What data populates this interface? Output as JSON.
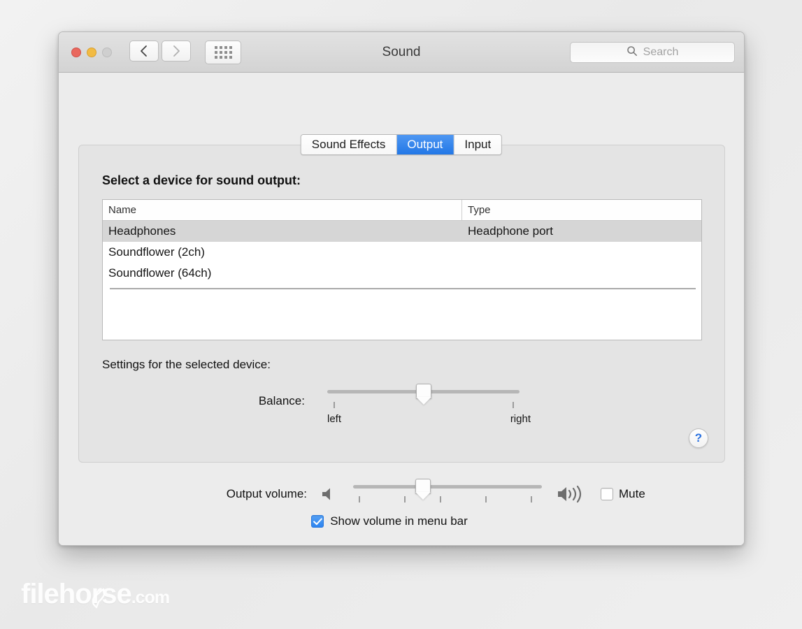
{
  "window": {
    "title": "Sound",
    "traffic_lights": [
      "close",
      "minimize",
      "zoom"
    ],
    "nav": {
      "back": "back-chevron",
      "forward": "forward-chevron",
      "show_all": "grid-icon"
    },
    "search": {
      "placeholder": "Search",
      "icon": "search-icon",
      "value": ""
    }
  },
  "tabs": [
    {
      "label": "Sound Effects",
      "selected": false
    },
    {
      "label": "Output",
      "selected": true
    },
    {
      "label": "Input",
      "selected": false
    }
  ],
  "panel": {
    "heading": "Select a device for sound output:",
    "table": {
      "columns": [
        "Name",
        "Type"
      ],
      "rows": [
        {
          "name": "Headphones",
          "type": "Headphone port",
          "selected": true
        },
        {
          "name": "Soundflower (2ch)",
          "type": "",
          "selected": false
        },
        {
          "name": "Soundflower (64ch)",
          "type": "",
          "selected": false
        }
      ]
    },
    "settings_label": "Settings for the selected device:",
    "balance": {
      "label": "Balance:",
      "left_label": "left",
      "right_label": "right",
      "value_percent": 50
    },
    "help_button": "?"
  },
  "output_volume": {
    "label": "Output volume:",
    "mute_icon": "speaker-off-icon",
    "loud_icon": "speaker-on-icon",
    "value_percent": 37,
    "mute": {
      "label": "Mute",
      "checked": false
    },
    "show_in_menu_bar": {
      "label": "Show volume in menu bar",
      "checked": true
    }
  },
  "watermark": {
    "name": "filehorse",
    "suffix": ".com"
  },
  "colors": {
    "accent_blue": "#2d84ef",
    "selected_tab_blue": "#3b8cf0",
    "window_bg": "#ececec",
    "panel_bg": "#e4e4e4",
    "selected_row": "#d6d6d6",
    "help_blue": "#2b72e0"
  }
}
